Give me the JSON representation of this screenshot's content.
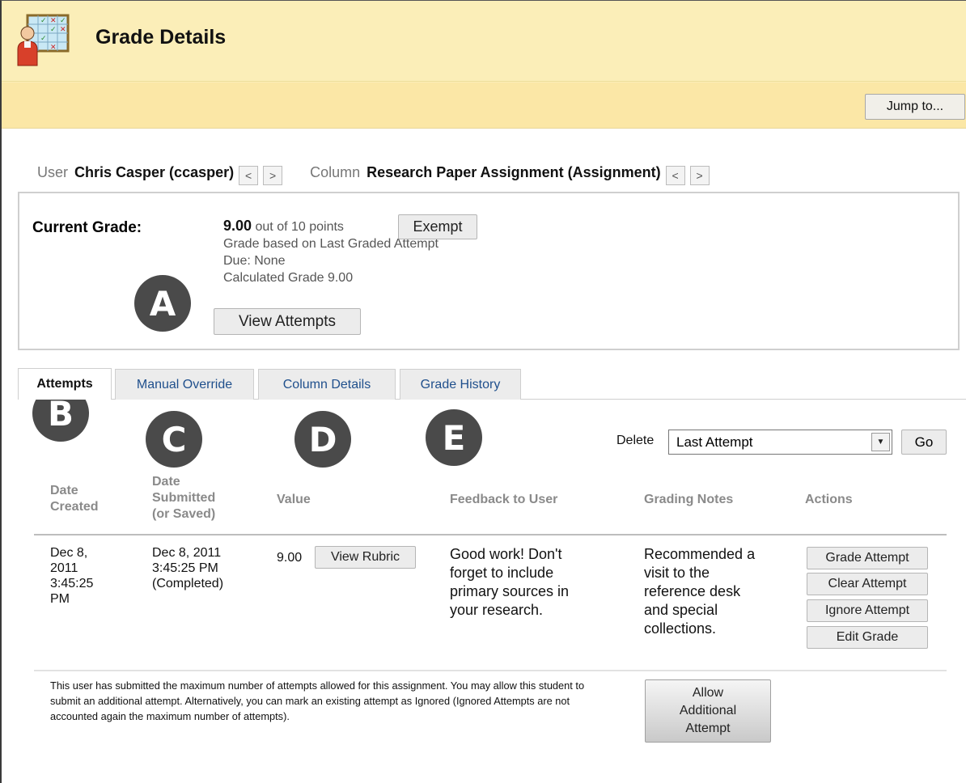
{
  "header": {
    "title": "Grade Details",
    "jump_button": "Jump to..."
  },
  "nav": {
    "user_label": "User",
    "user_value": "Chris Casper (ccasper)",
    "column_label": "Column",
    "column_value": "Research Paper Assignment (Assignment)",
    "prev_glyph": "<",
    "next_glyph": ">"
  },
  "current_grade": {
    "label": "Current Grade:",
    "score": "9.00",
    "out_of": "out of 10 points",
    "exempt_button": "Exempt",
    "basis": "Grade based on Last Graded Attempt",
    "due": "Due: None",
    "calculated": "Calculated Grade  9.00",
    "view_attempts_button": "View Attempts"
  },
  "callouts": [
    "A",
    "B",
    "C",
    "D",
    "E"
  ],
  "tabs": [
    {
      "label": "Attempts",
      "active": true
    },
    {
      "label": "Manual Override",
      "active": false
    },
    {
      "label": "Column Details",
      "active": false
    },
    {
      "label": "Grade History",
      "active": false
    }
  ],
  "delete": {
    "label": "Delete",
    "selected": "Last Attempt",
    "go_button": "Go"
  },
  "table": {
    "headers": {
      "date_created_1": "Date",
      "date_created_2": "Created",
      "date_submitted_1": "Date",
      "date_submitted_2": "Submitted",
      "date_submitted_3": "(or Saved)",
      "value": "Value",
      "feedback": "Feedback to User",
      "notes": "Grading Notes",
      "actions": "Actions"
    },
    "row": {
      "created_1": "Dec 8,",
      "created_2": "2011",
      "created_3": "3:45:25",
      "created_4": "PM",
      "submitted_1": "Dec 8, 2011",
      "submitted_2": "3:45:25 PM",
      "submitted_3": "(Completed)",
      "value": "9.00",
      "view_rubric_button": "View Rubric",
      "feedback_1": "Good work! Don't",
      "feedback_2": "forget to include",
      "feedback_3": "primary sources in",
      "feedback_4": "your research.",
      "notes_1": "Recommended a",
      "notes_2": "visit to the",
      "notes_3": "reference desk",
      "notes_4": "and special",
      "notes_5": "collections.",
      "actions": {
        "grade_attempt": "Grade Attempt",
        "clear_attempt": "Clear Attempt",
        "ignore_attempt": "Ignore Attempt",
        "edit_grade": "Edit Grade"
      }
    }
  },
  "footer": {
    "message": "This user has submitted the maximum number of attempts allowed for this assignment. You may allow this student to submit an additional attempt. Alternatively, you can mark an existing attempt as Ignored (Ignored Attempts are not accounted again the maximum number of attempts).",
    "allow_1": "Allow",
    "allow_2": "Additional",
    "allow_3": "Attempt"
  },
  "colors": {
    "header_bg": "#fbeeb8",
    "header_bar_bg": "#fbe7a6",
    "callout_bg": "#4a4a4a",
    "tab_link": "#1f4f8c"
  },
  "icons": {
    "header": "grade-center-teacher-icon",
    "select": "dropdown-arrow-icon"
  }
}
